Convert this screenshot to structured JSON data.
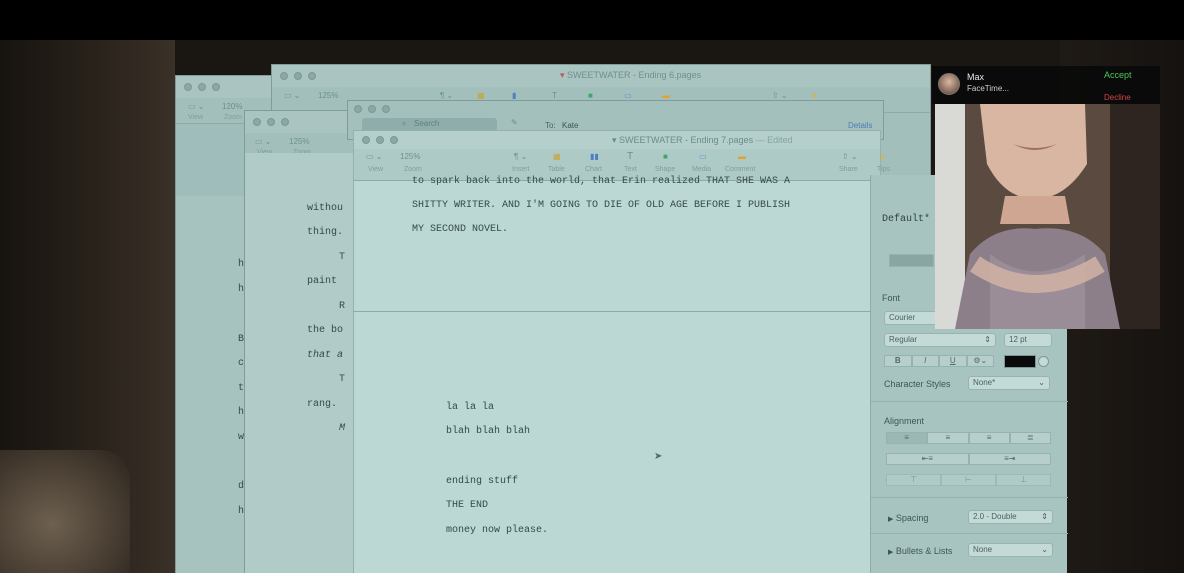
{
  "windows": {
    "back_left": {
      "zoom": "120%",
      "view_label": "View",
      "zoom_label": "Zoom",
      "margin_letters": [
        "h",
        "h",
        "B",
        "c",
        "t",
        "h",
        "w",
        "d",
        "h"
      ]
    },
    "ending6": {
      "title": "SWEETWATER - Ending 6.pages",
      "zoom": "125%"
    },
    "middle": {
      "zoom": "125%",
      "view_label": "View",
      "zoom_label": "Zoom",
      "lines": [
        "withou",
        "thing.",
        "T",
        "paint",
        "R",
        "the bo",
        "that a",
        "T",
        "rang.",
        "M"
      ]
    },
    "mail": {
      "search_placeholder": "Search",
      "to_label": "To:",
      "to_value": "Kate",
      "details_label": "Details"
    },
    "front": {
      "title": "SWEETWATER - Ending 7.pages",
      "title_suffix": "— Edited",
      "zoom": "125%",
      "toolbar": {
        "view": "View",
        "zoom": "Zoom",
        "insert": "Insert",
        "table": "Table",
        "chart": "Chart",
        "text": "Text",
        "shape": "Shape",
        "media": "Media",
        "comment": "Comment",
        "share": "Share",
        "tips": "Tips"
      },
      "upper_text": [
        "to spark back into the world, that Erin realized THAT SHE WAS A",
        "SHITTY WRITER. AND I'M GOING TO DIE OF OLD AGE BEFORE I PUBLISH",
        "MY SECOND NOVEL."
      ],
      "lower_text": [
        "la la la",
        "blah blah blah",
        "ending stuff",
        "THE END",
        "money now please."
      ]
    }
  },
  "inspector": {
    "style_name": "Default*",
    "font_label": "Font",
    "font_family": "Courier",
    "font_style": "Regular",
    "font_size": "12 pt",
    "bold": "B",
    "italic": "I",
    "underline": "U",
    "character_styles_label": "Character Styles",
    "character_styles_value": "None*",
    "alignment_label": "Alignment",
    "spacing_label": "Spacing",
    "spacing_value": "2.0 - Double",
    "bullets_label": "Bullets & Lists",
    "bullets_value": "None",
    "text_color": "#0a0a0a"
  },
  "facetime": {
    "caller": "Max",
    "subtitle": "FaceTime...",
    "accept": "Accept",
    "decline": "Decline"
  }
}
